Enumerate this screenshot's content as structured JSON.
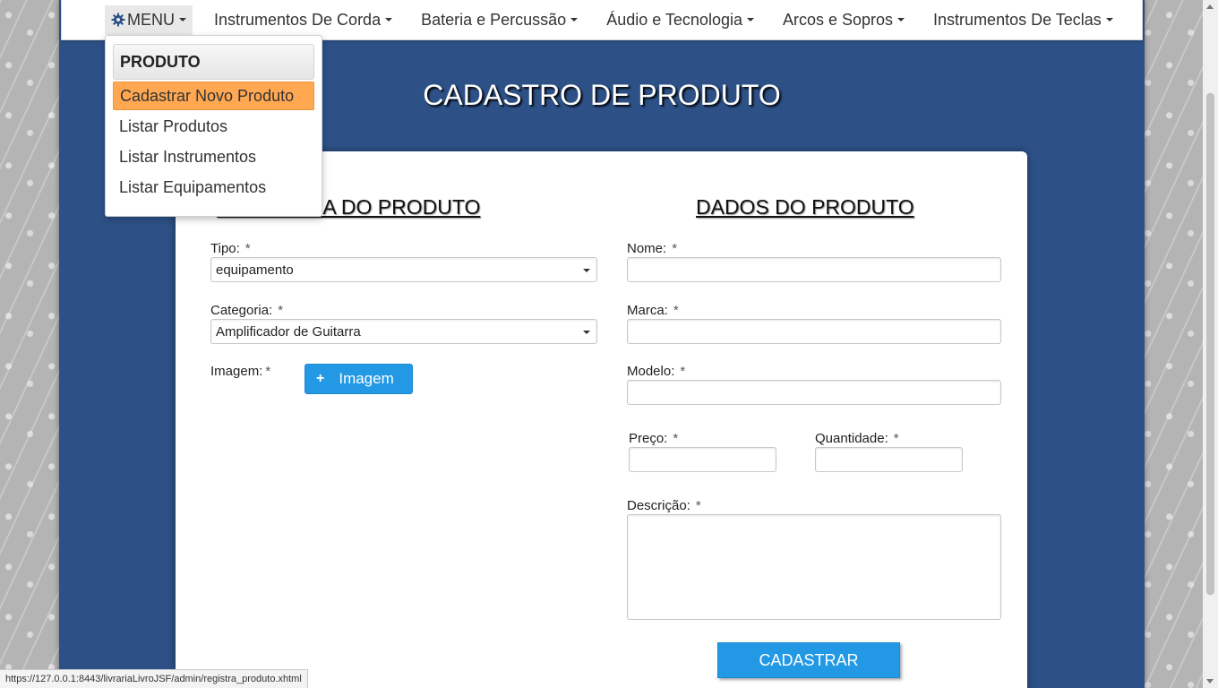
{
  "navbar": {
    "menu_label": "MENU",
    "items": [
      "Instrumentos De Corda",
      "Bateria e Percussão",
      "Áudio e Tecnologia",
      "Arcos e Sopros",
      "Instrumentos De Teclas"
    ]
  },
  "dropdown": {
    "header": "PRODUTO",
    "items": [
      "Cadastrar Novo Produto",
      "Listar Produtos",
      "Listar Instrumentos",
      "Listar Equipamentos"
    ],
    "active_index": 0
  },
  "page": {
    "title": "CADASTRO DE PRODUTO"
  },
  "form": {
    "left_title": "CATEGORIA DO PRODUTO",
    "right_title": "DADOS DO PRODUTO",
    "required_mark": "*",
    "tipo": {
      "label": "Tipo:",
      "value": "equipamento"
    },
    "categoria": {
      "label": "Categoria:",
      "value": "Amplificador de Guitarra"
    },
    "imagem": {
      "label": "Imagem:",
      "button_label": "Imagem",
      "button_icon": "+"
    },
    "nome": {
      "label": "Nome:",
      "value": ""
    },
    "marca": {
      "label": "Marca:",
      "value": ""
    },
    "modelo": {
      "label": "Modelo:",
      "value": ""
    },
    "preco": {
      "label": "Preço:",
      "value": ""
    },
    "quantidade": {
      "label": "Quantidade:",
      "value": ""
    },
    "descricao": {
      "label": "Descrição:",
      "value": ""
    },
    "submit_label": "CADASTRAR"
  },
  "status_bar": {
    "url": "https://127.0.0.1:8443/livrariaLivroJSF/admin/registra_produto.xhtml"
  },
  "colors": {
    "page_background": "#2d5187",
    "active_menu_item": "#ffa851",
    "button": "#2399e5"
  }
}
